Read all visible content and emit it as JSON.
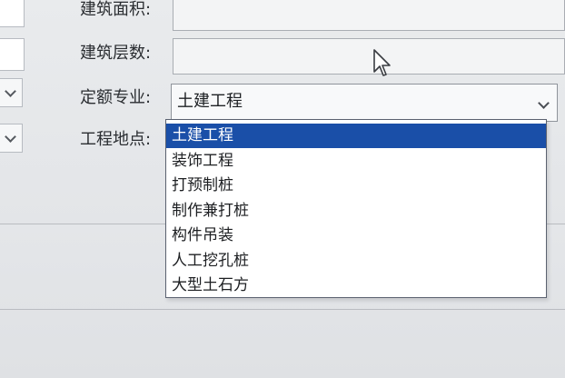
{
  "form": {
    "area_label": "建筑面积:",
    "floors_label": "建筑层数:",
    "specialty_label": "定额专业:",
    "location_label": "工程地点:",
    "area_value": "",
    "floors_value": ""
  },
  "specialty_combo": {
    "selected": "土建工程",
    "options": [
      "土建工程",
      "装饰工程",
      "打预制桩",
      "制作兼打桩",
      "构件吊装",
      "人工挖孔桩",
      "大型土石方"
    ],
    "selected_index": 0
  },
  "colors": {
    "selection": "#1a4fa8",
    "window_bg": "#e8eaec"
  },
  "icons": {
    "cursor": "mouse-pointer-icon",
    "dropdown": "chevron-down-icon"
  }
}
